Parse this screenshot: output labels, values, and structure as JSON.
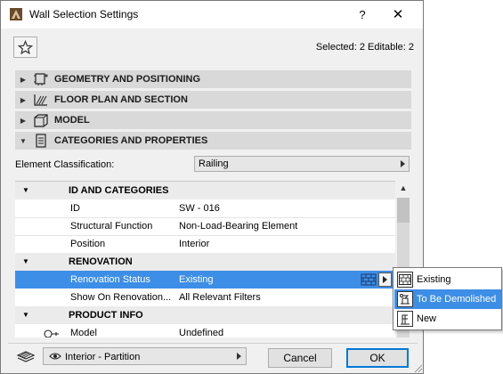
{
  "window": {
    "title": "Wall Selection Settings",
    "help_label": "?",
    "close_label": "✕"
  },
  "toolbar": {
    "selected_info": "Selected: 2 Editable: 2"
  },
  "panels": [
    {
      "label": "GEOMETRY AND POSITIONING",
      "icon": "geometry-icon"
    },
    {
      "label": "FLOOR PLAN AND SECTION",
      "icon": "floor-plan-icon"
    },
    {
      "label": "MODEL",
      "icon": "model-box-icon"
    },
    {
      "label": "CATEGORIES AND PROPERTIES",
      "icon": "properties-list-icon"
    }
  ],
  "classification": {
    "label": "Element Classification:",
    "value": "Railing"
  },
  "properties": {
    "groups": [
      {
        "title": "ID AND CATEGORIES",
        "rows": [
          {
            "name": "ID",
            "value": "SW - 016"
          },
          {
            "name": "Structural Function",
            "value": "Non-Load-Bearing Element"
          },
          {
            "name": "Position",
            "value": "Interior"
          }
        ]
      },
      {
        "title": "RENOVATION",
        "rows": [
          {
            "name": "Renovation Status",
            "value": "Existing"
          },
          {
            "name": "Show On Renovation...",
            "value": "All Relevant Filters"
          }
        ]
      },
      {
        "title": "PRODUCT INFO",
        "rows": [
          {
            "name": "Model",
            "value": "Undefined"
          }
        ]
      }
    ]
  },
  "renovation_popup": {
    "items": [
      {
        "label": "Existing",
        "icon": "existing-brick-icon",
        "active": false
      },
      {
        "label": "To Be Demolished",
        "icon": "demolish-icon",
        "active": true
      },
      {
        "label": "New",
        "icon": "new-construction-icon",
        "active": false
      }
    ]
  },
  "footer": {
    "layer_value": "Interior - Partition",
    "cancel_label": "Cancel",
    "ok_label": "OK"
  },
  "colors": {
    "selection": "#3d8ee6",
    "panel_header": "#d9d9d9",
    "dialog_bg": "#f0f0f0"
  }
}
